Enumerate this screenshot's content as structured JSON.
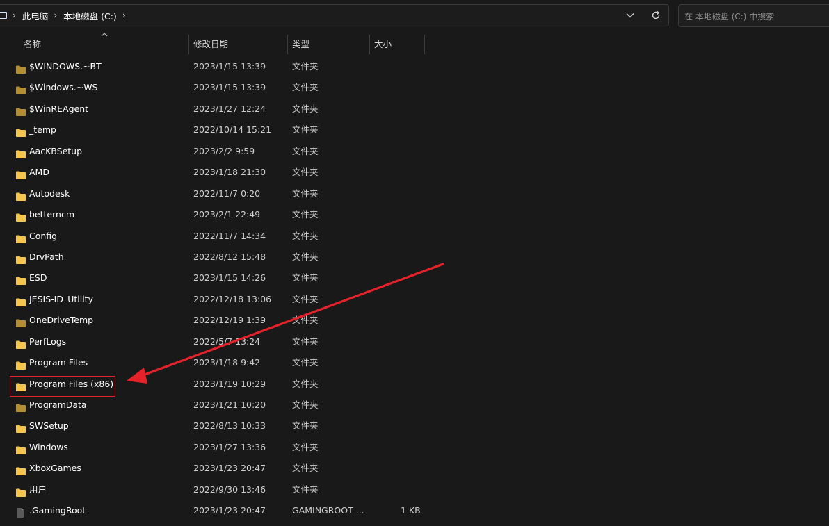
{
  "breadcrumb": {
    "items": [
      "此电脑",
      "本地磁盘 (C:)"
    ]
  },
  "search": {
    "placeholder": "在 本地磁盘 (C:) 中搜索"
  },
  "columns": {
    "name": "名称",
    "date": "修改日期",
    "type": "类型",
    "size": "大小"
  },
  "files": [
    {
      "name": "$WINDOWS.~BT",
      "date": "2023/1/15 13:39",
      "type": "文件夹",
      "size": "",
      "kind": "folder-dim"
    },
    {
      "name": "$Windows.~WS",
      "date": "2023/1/15 13:39",
      "type": "文件夹",
      "size": "",
      "kind": "folder-dim"
    },
    {
      "name": "$WinREAgent",
      "date": "2023/1/27 12:24",
      "type": "文件夹",
      "size": "",
      "kind": "folder-dim"
    },
    {
      "name": "_temp",
      "date": "2022/10/14 15:21",
      "type": "文件夹",
      "size": "",
      "kind": "folder"
    },
    {
      "name": "AacKBSetup",
      "date": "2023/2/2 9:59",
      "type": "文件夹",
      "size": "",
      "kind": "folder"
    },
    {
      "name": "AMD",
      "date": "2023/1/18 21:30",
      "type": "文件夹",
      "size": "",
      "kind": "folder"
    },
    {
      "name": "Autodesk",
      "date": "2022/11/7 0:20",
      "type": "文件夹",
      "size": "",
      "kind": "folder"
    },
    {
      "name": "betterncm",
      "date": "2023/2/1 22:49",
      "type": "文件夹",
      "size": "",
      "kind": "folder"
    },
    {
      "name": "Config",
      "date": "2022/11/7 14:34",
      "type": "文件夹",
      "size": "",
      "kind": "folder"
    },
    {
      "name": "DrvPath",
      "date": "2022/8/12 15:48",
      "type": "文件夹",
      "size": "",
      "kind": "folder"
    },
    {
      "name": "ESD",
      "date": "2023/1/15 14:26",
      "type": "文件夹",
      "size": "",
      "kind": "folder"
    },
    {
      "name": "JESIS-ID_Utility",
      "date": "2022/12/18 13:06",
      "type": "文件夹",
      "size": "",
      "kind": "folder"
    },
    {
      "name": "OneDriveTemp",
      "date": "2022/12/19 1:39",
      "type": "文件夹",
      "size": "",
      "kind": "folder-dim"
    },
    {
      "name": "PerfLogs",
      "date": "2022/5/7 13:24",
      "type": "文件夹",
      "size": "",
      "kind": "folder"
    },
    {
      "name": "Program Files",
      "date": "2023/1/18 9:42",
      "type": "文件夹",
      "size": "",
      "kind": "folder"
    },
    {
      "name": "Program Files (x86)",
      "date": "2023/1/19 10:29",
      "type": "文件夹",
      "size": "",
      "kind": "folder"
    },
    {
      "name": "ProgramData",
      "date": "2023/1/21 10:20",
      "type": "文件夹",
      "size": "",
      "kind": "folder-dim"
    },
    {
      "name": "SWSetup",
      "date": "2022/8/13 10:33",
      "type": "文件夹",
      "size": "",
      "kind": "folder"
    },
    {
      "name": "Windows",
      "date": "2023/1/27 13:36",
      "type": "文件夹",
      "size": "",
      "kind": "folder"
    },
    {
      "name": "XboxGames",
      "date": "2023/1/23 20:47",
      "type": "文件夹",
      "size": "",
      "kind": "folder"
    },
    {
      "name": "用户",
      "date": "2022/9/30 13:46",
      "type": "文件夹",
      "size": "",
      "kind": "folder"
    },
    {
      "name": ".GamingRoot",
      "date": "2023/1/23 20:47",
      "type": "GAMINGROOT ...",
      "size": "1 KB",
      "kind": "file"
    }
  ],
  "colors": {
    "folder": "#f3c54d",
    "folder_dim": "#b38f33",
    "annotation": "#e5222a",
    "background": "#191919"
  }
}
